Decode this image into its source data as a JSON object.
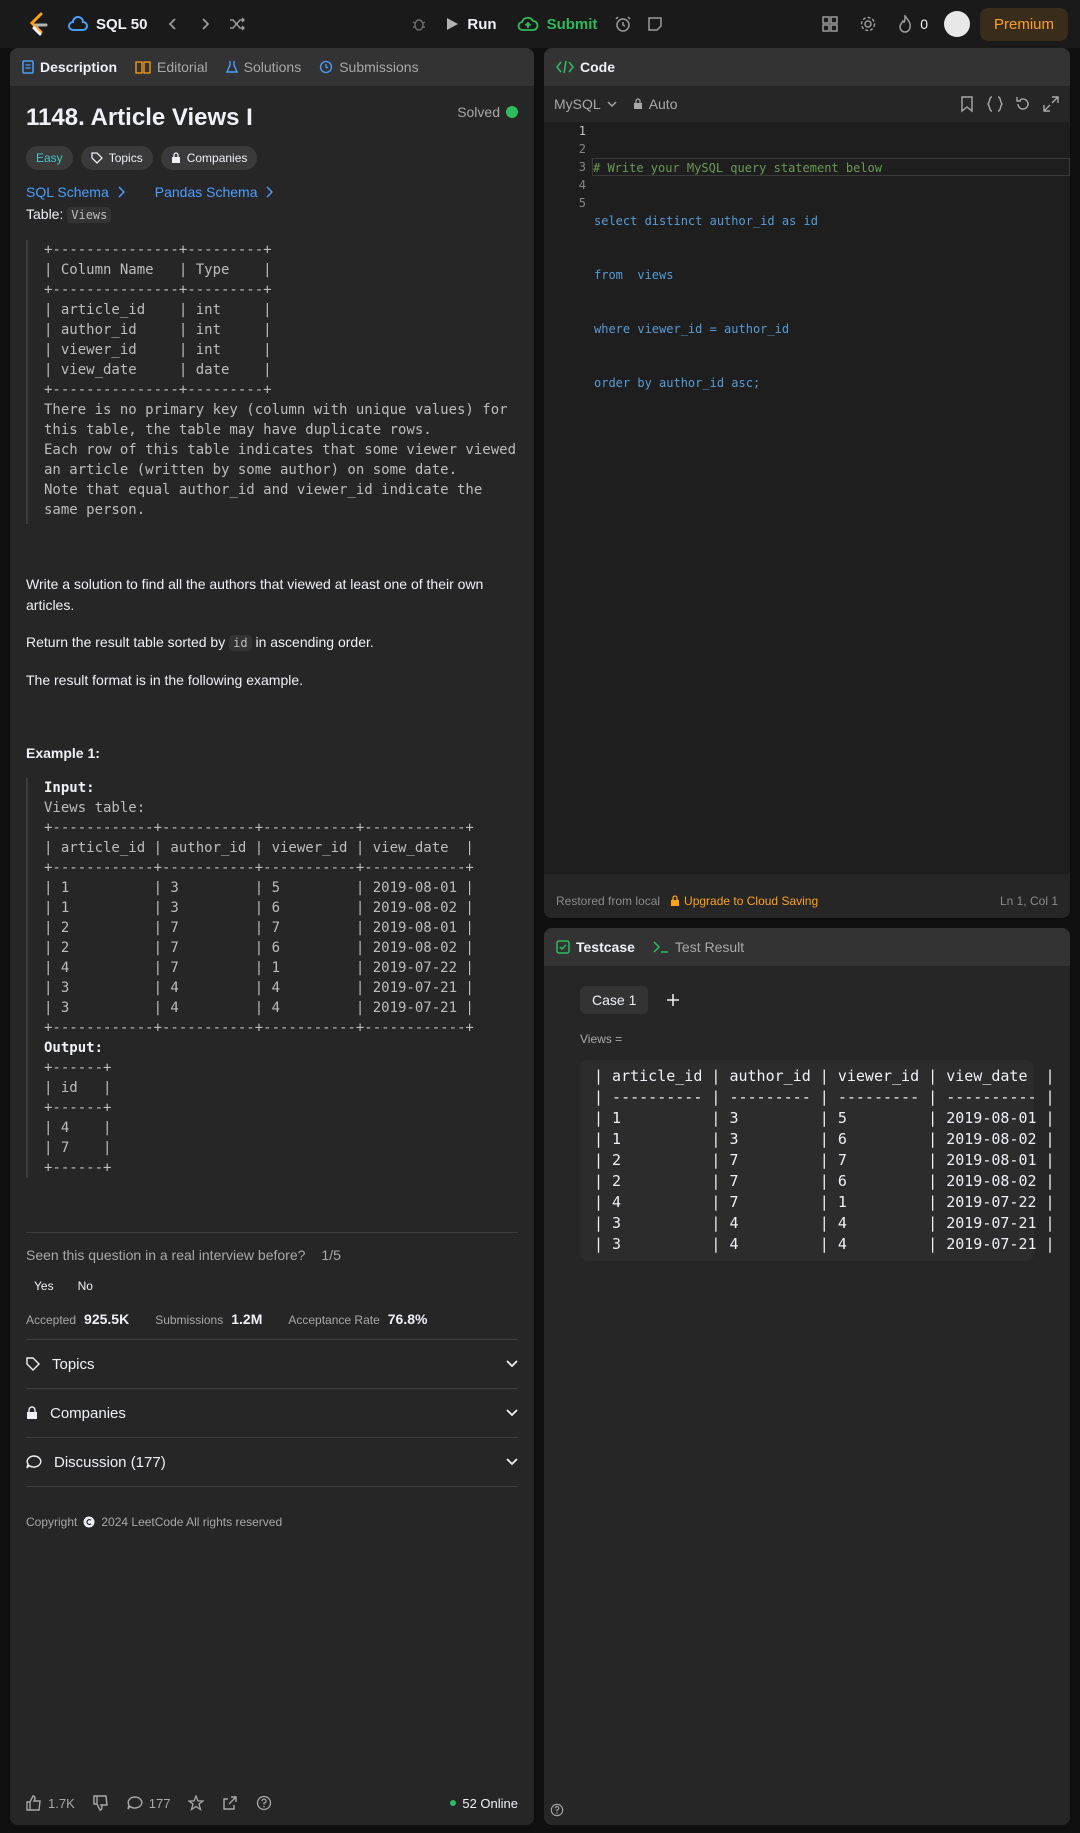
{
  "nav": {
    "list_name": "SQL 50",
    "run_label": "Run",
    "submit_label": "Submit",
    "streak_count": "0",
    "premium_label": "Premium"
  },
  "left_tabs": [
    {
      "label": "Description",
      "icon": "document-icon"
    },
    {
      "label": "Editorial",
      "icon": "book-icon"
    },
    {
      "label": "Solutions",
      "icon": "flask-icon"
    },
    {
      "label": "Submissions",
      "icon": "history-icon"
    }
  ],
  "problem": {
    "title": "1148. Article Views I",
    "status": "Solved",
    "difficulty": "Easy",
    "topics_chip": "Topics",
    "companies_chip": "Companies",
    "sql_schema": "SQL Schema",
    "pandas_schema": "Pandas Schema",
    "table_label": "Table:",
    "table_name": "Views",
    "schema_block": "+---------------+---------+\n| Column Name   | Type    |\n+---------------+---------+\n| article_id    | int     |\n| author_id     | int     |\n| viewer_id     | int     |\n| view_date     | date    |\n+---------------+---------+\nThere is no primary key (column with unique values) for\nthis table, the table may have duplicate rows.\nEach row of this table indicates that some viewer viewed\nan article (written by some author) on some date.\nNote that equal author_id and viewer_id indicate the\nsame person.",
    "para1": "Write a solution to find all the authors that viewed at least one of their own articles.",
    "para2_pre": "Return the result table sorted by",
    "para2_code": "id",
    "para2_post": "in ascending order.",
    "para3": "The result format is in the following example.",
    "example_title": "Example 1:",
    "input_label": "Input:",
    "example_block": "Views table:\n+------------+-----------+-----------+------------+\n| article_id | author_id | viewer_id | view_date  |\n+------------+-----------+-----------+------------+\n| 1          | 3         | 5         | 2019-08-01 |\n| 1          | 3         | 6         | 2019-08-02 |\n| 2          | 7         | 7         | 2019-08-01 |\n| 2          | 7         | 6         | 2019-08-02 |\n| 4          | 7         | 1         | 2019-07-22 |\n| 3          | 4         | 4         | 2019-07-21 |\n| 3          | 4         | 4         | 2019-07-21 |\n+------------+-----------+-----------+------------+",
    "output_label": "Output:",
    "output_block": "+------+\n| id   |\n+------+\n| 4    |\n| 7    |\n+------+",
    "interview_q": "Seen this question in a real interview before?",
    "interview_count": "1/5",
    "yes": "Yes",
    "no": "No",
    "accepted_label": "Accepted",
    "accepted_value": "925.5K",
    "submissions_label": "Submissions",
    "submissions_value": "1.2M",
    "rate_label": "Acceptance Rate",
    "rate_value": "76.8%",
    "topics_row": "Topics",
    "companies_row": "Companies",
    "discussion_row": "Discussion (177)",
    "copyright": "Copyright",
    "copyright_rest": "2024 LeetCode All rights reserved"
  },
  "footer": {
    "likes": "1.7K",
    "comments": "177",
    "online": "52 Online"
  },
  "code_panel": {
    "tab": "Code",
    "language": "MySQL",
    "mode": "Auto",
    "lines": [
      {
        "no": "1",
        "text": "# Write your MySQL query statement below"
      },
      {
        "no": "2",
        "text": "select distinct author_id as id"
      },
      {
        "no": "3",
        "text": "from  views"
      },
      {
        "no": "4",
        "text": "where viewer_id = author_id"
      },
      {
        "no": "5",
        "text": "order by author_id asc;"
      }
    ],
    "restored": "Restored from local",
    "upgrade": "Upgrade to Cloud Saving",
    "position": "Ln 1, Col 1"
  },
  "test_panel": {
    "tab_testcase": "Testcase",
    "tab_result": "Test Result",
    "case_label": "Case 1",
    "var_label": "Views =",
    "table": "| article_id | author_id | viewer_id | view_date  |\n| ---------- | --------- | --------- | ---------- |\n| 1          | 3         | 5         | 2019-08-01 |\n| 1          | 3         | 6         | 2019-08-02 |\n| 2          | 7         | 7         | 2019-08-01 |\n| 2          | 7         | 6         | 2019-08-02 |\n| 4          | 7         | 1         | 2019-07-22 |\n| 3          | 4         | 4         | 2019-07-21 |\n| 3          | 4         | 4         | 2019-07-21 |"
  },
  "colors": {
    "accent_green": "#2cbb5d",
    "premium_orange": "#ffa116",
    "link_blue": "#4a9eff",
    "easy_teal": "#46c6c2"
  }
}
